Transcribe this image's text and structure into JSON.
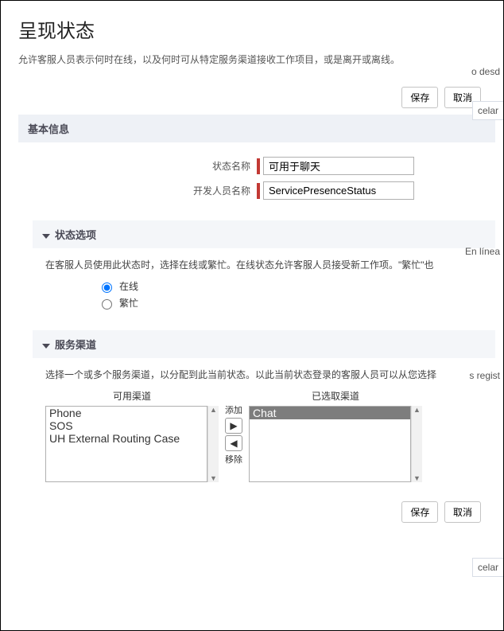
{
  "bg": {
    "frag1": "o desd",
    "frag2": "celar",
    "frag3": "En línea",
    "frag4": "s regist",
    "frag5": "celar"
  },
  "page": {
    "title": "呈现状态",
    "desc": "允许客服人员表示何时在线，以及何时可从特定服务渠道接收工作项目，或是离开或离线。"
  },
  "buttons": {
    "save": "保存",
    "cancel": "取消"
  },
  "basic": {
    "header": "基本信息",
    "status_name_label": "状态名称",
    "status_name_value": "可用于聊天",
    "dev_name_label": "开发人员名称",
    "dev_name_value": "ServicePresenceStatus"
  },
  "options": {
    "header": "状态选项",
    "desc": "在客服人员使用此状态时，选择在线或繁忙。在线状态允许客服人员接受新工作项。\"繁忙\"也",
    "online": "在线",
    "busy": "繁忙"
  },
  "channels": {
    "header": "服务渠道",
    "desc": "选择一个或多个服务渠道，以分配到此当前状态。以此当前状态登录的客服人员可以从您选择",
    "available_label": "可用渠道",
    "selected_label": "已选取渠道",
    "add_label": "添加",
    "remove_label": "移除",
    "available": [
      "Phone",
      "SOS",
      "UH External Routing Case"
    ],
    "selected": [
      "Chat"
    ]
  }
}
